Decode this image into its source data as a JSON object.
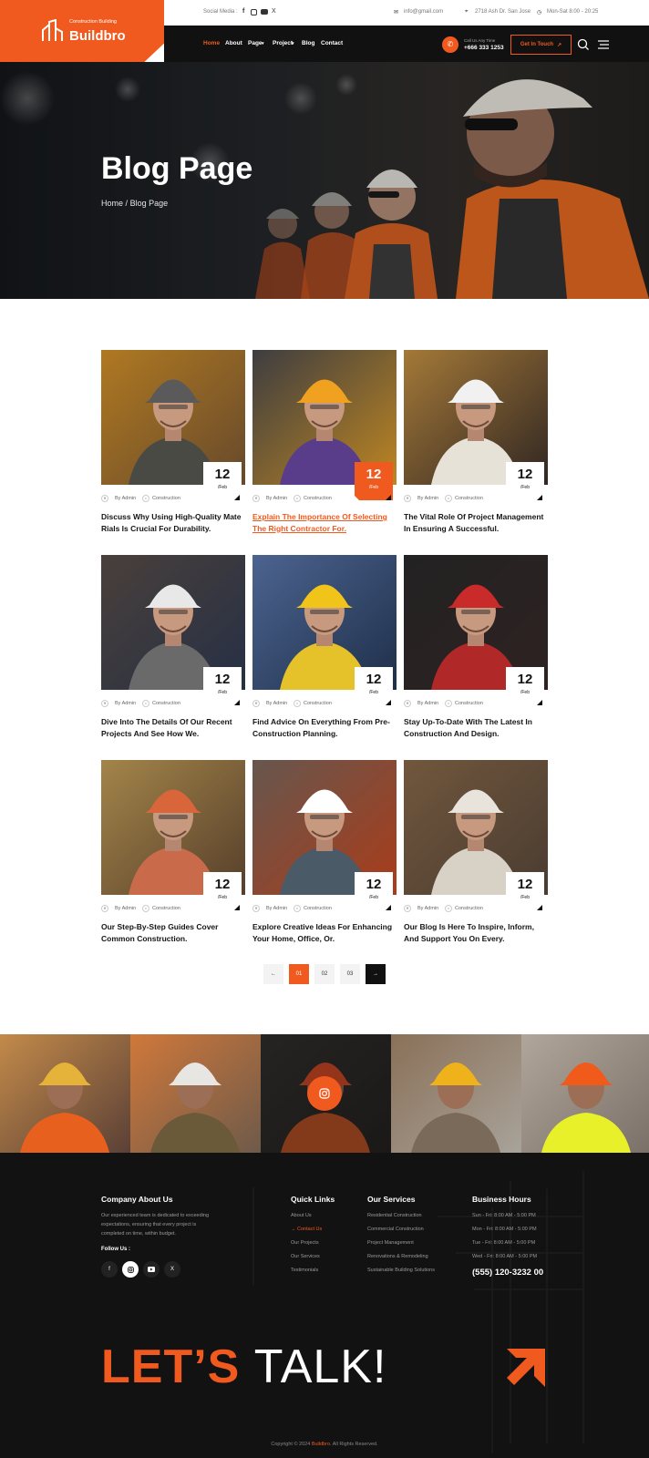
{
  "brand": {
    "tagline": "Construction Building",
    "name": "Buildbro",
    "accent": "#f15a1f"
  },
  "topbar": {
    "social_label": "Social Media :",
    "email": "info@gmail.com",
    "address": "2718 Ash Dr. San Jose",
    "hours": "Mon-Sat 8:00 - 20:25"
  },
  "nav": {
    "items": [
      "Home",
      "About",
      "Page",
      "Project",
      "Blog",
      "Contact"
    ],
    "call_label": "Call Us Any Time",
    "call_number": "+666 333 1253",
    "cta": "Get In Touch"
  },
  "hero": {
    "title": "Blog Page",
    "crumb_home": "Home",
    "crumb_sep": "/",
    "crumb_current": "Blog Page"
  },
  "posts": [
    {
      "day": "12",
      "month": "/Feb",
      "author": "By Admin",
      "category": "Construction",
      "title": "Discuss Why Using High-Quality Mate Rials Is Crucial For Durability."
    },
    {
      "day": "12",
      "month": "/Feb",
      "author": "By Admin",
      "category": "Construction",
      "title": "Explain The Importance Of Selecting The Right Contractor For."
    },
    {
      "day": "12",
      "month": "/Feb",
      "author": "By Admin",
      "category": "Construction",
      "title": "The Vital Role Of Project Management In Ensuring A Successful."
    },
    {
      "day": "12",
      "month": "/Feb",
      "author": "By Admin",
      "category": "Construction",
      "title": "Dive Into The Details Of Our Recent Projects And See How We."
    },
    {
      "day": "12",
      "month": "/Feb",
      "author": "By Admin",
      "category": "Construction",
      "title": "Find Advice On Everything From Pre-Construction Planning."
    },
    {
      "day": "12",
      "month": "/Feb",
      "author": "By Admin",
      "category": "Construction",
      "title": "Stay Up-To-Date With The Latest In Construction And Design."
    },
    {
      "day": "12",
      "month": "/Feb",
      "author": "By Admin",
      "category": "Construction",
      "title": "Our Step-By-Step Guides Cover Common Construction."
    },
    {
      "day": "12",
      "month": "/Feb",
      "author": "By Admin",
      "category": "Construction",
      "title": "Explore Creative Ideas For Enhancing Your Home, Office, Or."
    },
    {
      "day": "12",
      "month": "/Feb",
      "author": "By Admin",
      "category": "Construction",
      "title": "Our Blog Is Here To Inspire, Inform, And Support You On Every."
    }
  ],
  "pagination": {
    "prev": "←",
    "pages": [
      "01",
      "02",
      "03"
    ],
    "next": "→"
  },
  "footer": {
    "about_title": "Company About Us",
    "about_text": [
      "Our experienced team is dedicated to exceeding",
      "expectations, ensuring that every project is",
      "completed on time, within budget."
    ],
    "follow_label": "Follow Us :",
    "social": [
      "f",
      "ig",
      "yt",
      "X"
    ],
    "links_title": "Quick Links",
    "links": [
      "About Us",
      "→ Contact Us",
      "Our Projects",
      "Our Services",
      "Testimonials"
    ],
    "services_title": "Our Services",
    "services": [
      "Residential Construction",
      "Commercial Construction",
      "Project Management",
      "Renovations & Remodeling",
      "Sustainable Building Solutions"
    ],
    "hours_title": "Business Hours",
    "hours": [
      "Sun - Fri: 8:00 AM - 5:00 PM",
      "Mon - Fri: 8:00 AM - 5:00 PM",
      "Tue - Fri: 8:00 AM - 5:00 PM",
      "Wed - Fri: 8:00 AM - 5:00 PM"
    ],
    "phone": "(555) 120-3232 00",
    "lets_orange": "LET’S",
    "lets_white": "TALK!",
    "copyright_pre": "Copyright © 2024",
    "copyright_brand": "Buildbro",
    "copyright_post": ". All Rights Reserved."
  }
}
